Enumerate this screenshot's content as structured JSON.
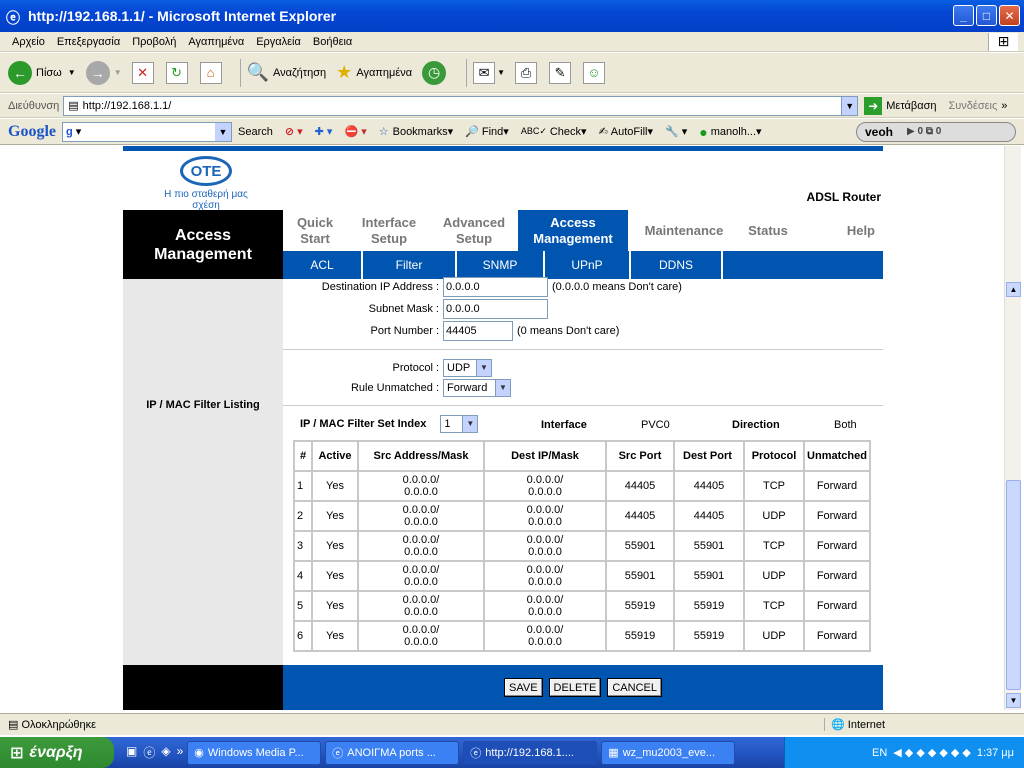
{
  "window": {
    "title": "http://192.168.1.1/ - Microsoft Internet Explorer"
  },
  "menu": [
    "Αρχείο",
    "Επεξεργασία",
    "Προβολή",
    "Αγαπημένα",
    "Εργαλεία",
    "Βοήθεια"
  ],
  "toolbar": {
    "back": "Πίσω",
    "search": "Αναζήτηση",
    "favorites": "Αγαπημένα"
  },
  "address": {
    "label": "Διεύθυνση",
    "url": "http://192.168.1.1/",
    "go": "Μετάβαση",
    "links": "Συνδέσεις"
  },
  "googlebar": {
    "logo": "Google",
    "search_field": "g",
    "search": "Search",
    "bookmarks": "Bookmarks",
    "find": "Find",
    "check": "Check",
    "autofill": "AutoFill",
    "user": "manolh...",
    "veoh": "veoh"
  },
  "router": {
    "brand": "OTE",
    "tagline": "Η πιο σταθερή μας σχέση",
    "product": "ADSL Router",
    "section_title": "Access Management",
    "tabs": [
      {
        "label": "Quick Start"
      },
      {
        "label": "Interface Setup"
      },
      {
        "label": "Advanced Setup"
      },
      {
        "label": "Access Management"
      },
      {
        "label": "Maintenance"
      },
      {
        "label": "Status"
      },
      {
        "label": "Help"
      }
    ],
    "subtabs": [
      "ACL",
      "Filter",
      "SNMP",
      "UPnP",
      "DDNS"
    ],
    "left_label": "IP / MAC Filter Listing",
    "form": {
      "dest_ip_label": "Destination IP Address :",
      "dest_ip_value": "0.0.0.0",
      "dest_ip_note": "(0.0.0.0 means Don't care)",
      "subnet_label": "Subnet Mask :",
      "subnet_value": "0.0.0.0",
      "port_label": "Port Number :",
      "port_value": "44405",
      "port_note": "(0 means Don't care)",
      "protocol_label": "Protocol :",
      "protocol_value": "UDP",
      "rule_label": "Rule Unmatched :",
      "rule_value": "Forward"
    },
    "listing": {
      "index_label": "IP / MAC Filter Set Index",
      "index_value": "1",
      "interface_label": "Interface",
      "interface_value": "PVC0",
      "direction_label": "Direction",
      "direction_value": "Both"
    },
    "table": {
      "headers": [
        "#",
        "Active",
        "Src Address/Mask",
        "Dest IP/Mask",
        "Src Port",
        "Dest Port",
        "Protocol",
        "Unmatched"
      ],
      "rows": [
        [
          "1",
          "Yes",
          "0.0.0.0/ 0.0.0.0",
          "0.0.0.0/ 0.0.0.0",
          "44405",
          "44405",
          "TCP",
          "Forward"
        ],
        [
          "2",
          "Yes",
          "0.0.0.0/ 0.0.0.0",
          "0.0.0.0/ 0.0.0.0",
          "44405",
          "44405",
          "UDP",
          "Forward"
        ],
        [
          "3",
          "Yes",
          "0.0.0.0/ 0.0.0.0",
          "0.0.0.0/ 0.0.0.0",
          "55901",
          "55901",
          "TCP",
          "Forward"
        ],
        [
          "4",
          "Yes",
          "0.0.0.0/ 0.0.0.0",
          "0.0.0.0/ 0.0.0.0",
          "55901",
          "55901",
          "UDP",
          "Forward"
        ],
        [
          "5",
          "Yes",
          "0.0.0.0/ 0.0.0.0",
          "0.0.0.0/ 0.0.0.0",
          "55919",
          "55919",
          "TCP",
          "Forward"
        ],
        [
          "6",
          "Yes",
          "0.0.0.0/ 0.0.0.0",
          "0.0.0.0/ 0.0.0.0",
          "55919",
          "55919",
          "UDP",
          "Forward"
        ]
      ]
    },
    "buttons": {
      "save": "SAVE",
      "delete": "DELETE",
      "cancel": "CANCEL"
    }
  },
  "status": {
    "text": "Ολοκληρώθηκε",
    "zone": "Internet"
  },
  "taskbar": {
    "start": "έναρξη",
    "tasks": [
      "Windows Media P...",
      "ΑΝΟΙΓΜΑ ports ...",
      "http://192.168.1....",
      "wz_mu2003_eve..."
    ],
    "lang": "EN",
    "clock": "1:37 μμ"
  },
  "colors": {
    "accent": "#0055b0",
    "black_bar": "#000000"
  }
}
